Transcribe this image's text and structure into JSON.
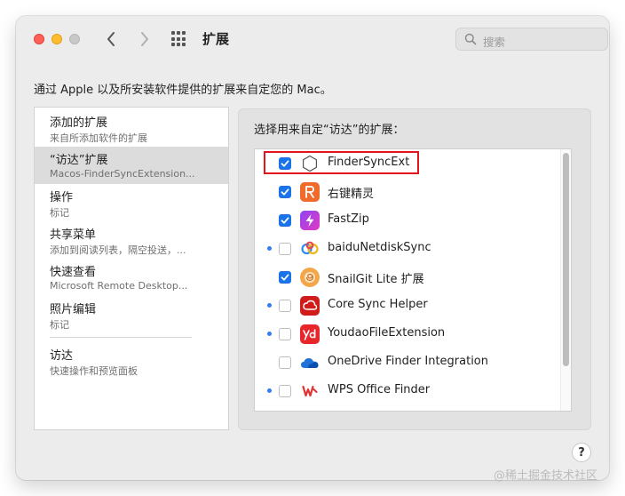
{
  "window": {
    "title": "扩展"
  },
  "search": {
    "placeholder": "搜索"
  },
  "description": "通过 Apple 以及所安装软件提供的扩展来自定您的 Mac。",
  "categories": [
    {
      "title": "添加的扩展",
      "subtitle": "来自所添加软件的扩展",
      "selected": false
    },
    {
      "title": "“访达”扩展",
      "subtitle": "Macos-FinderSyncExtension...",
      "selected": true
    },
    {
      "title": "操作",
      "subtitle": "标记",
      "selected": false
    },
    {
      "title": "共享菜单",
      "subtitle": "添加到阅读列表，隔空投送，...",
      "selected": false
    },
    {
      "title": "快速查看",
      "subtitle": "Microsoft Remote Desktop...",
      "selected": false
    },
    {
      "title": "照片编辑",
      "subtitle": "标记",
      "selected": false
    },
    {
      "title": "访达",
      "subtitle": "快速操作和预览面板",
      "selected": false
    }
  ],
  "right_panel": {
    "title": "选择用来自定“访达”的扩展：",
    "items": [
      {
        "label": "FinderSyncExt",
        "checked": true,
        "dot": false,
        "icon": "hexagon-outline-icon"
      },
      {
        "label": "右键精灵",
        "checked": true,
        "dot": false,
        "icon": "right-click-genie-icon"
      },
      {
        "label": "FastZip",
        "checked": true,
        "dot": false,
        "icon": "fastzip-bolt-icon"
      },
      {
        "label": "baiduNetdiskSync",
        "checked": false,
        "dot": true,
        "icon": "baidu-netdisk-icon"
      },
      {
        "label": "SnailGit Lite 扩展",
        "checked": true,
        "dot": false,
        "icon": "snailgit-icon"
      },
      {
        "label": "Core Sync Helper",
        "checked": false,
        "dot": true,
        "icon": "adobe-creative-cloud-icon"
      },
      {
        "label": "YoudaoFileExtension",
        "checked": false,
        "dot": true,
        "icon": "youdao-icon"
      },
      {
        "label": "OneDrive Finder Integration",
        "checked": false,
        "dot": false,
        "icon": "onedrive-cloud-icon"
      },
      {
        "label": "WPS Office Finder",
        "checked": false,
        "dot": true,
        "icon": "wps-office-icon"
      }
    ]
  },
  "help": {
    "label": "?"
  },
  "watermark": "@稀土掘金技术社区",
  "colors": {
    "accent": "#1a73e8",
    "highlight_border": "#e3141c",
    "new_dot": "#2f7ef6",
    "close": "#fe5f57",
    "minimize": "#febc2e"
  }
}
